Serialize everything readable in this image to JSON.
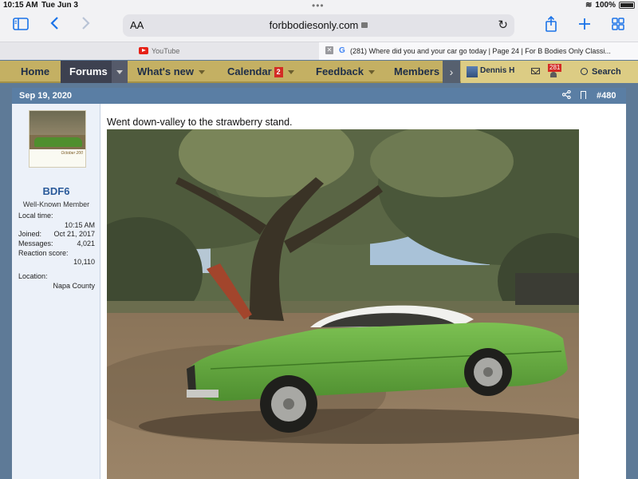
{
  "status_bar": {
    "time": "10:15 AM",
    "date": "Tue Jun 3",
    "battery": "100%"
  },
  "browser": {
    "reader_label": "AA",
    "url": "forbbodiesonly.com",
    "tabs": [
      {
        "label": "YouTube",
        "active": false
      },
      {
        "label": "(281) Where did you and your car go today | Page 24 | For B Bodies Only Classi...",
        "active": true
      }
    ]
  },
  "nav": {
    "items": [
      {
        "label": "Home"
      },
      {
        "label": "Forums"
      },
      {
        "label": "What's new"
      },
      {
        "label": "Calendar",
        "badge": "2"
      },
      {
        "label": "Feedback"
      },
      {
        "label": "Members"
      }
    ],
    "user": {
      "name": "Dennis H",
      "alerts": "281"
    },
    "search_label": "Search"
  },
  "post": {
    "date": "Sep 19, 2020",
    "number": "#480",
    "author": {
      "name": "BDF6",
      "title": "Well-Known Member",
      "avatar_caption": "October 200",
      "local_time_label": "Local time:",
      "local_time": "10:15 AM",
      "joined_label": "Joined:",
      "joined": "Oct 21, 2017",
      "messages_label": "Messages:",
      "messages": "4,021",
      "reaction_label": "Reaction score:",
      "reaction": "10,110",
      "location_label": "Location:",
      "location": "Napa County"
    },
    "text": "Went down-valley to the strawberry stand."
  },
  "colors": {
    "forum_nav": "#c4b063",
    "nav_active": "#3d4150",
    "post_header": "#5a7ea4",
    "username": "#2a5a9a",
    "badge": "#d32c25",
    "car_green": "#5ea33a"
  },
  "icons": {
    "sidebar": "sidebar-icon",
    "back": "chevron-left-icon",
    "forward": "chevron-right-icon",
    "lock": "lock-icon",
    "reload": "reload-icon",
    "share": "share-icon",
    "new_tab": "plus-icon",
    "tabs": "tabs-grid-icon",
    "search": "search-icon",
    "mail": "mail-icon",
    "bell": "bell-icon",
    "post_share": "share-nodes-icon",
    "bookmark": "bookmark-icon"
  }
}
